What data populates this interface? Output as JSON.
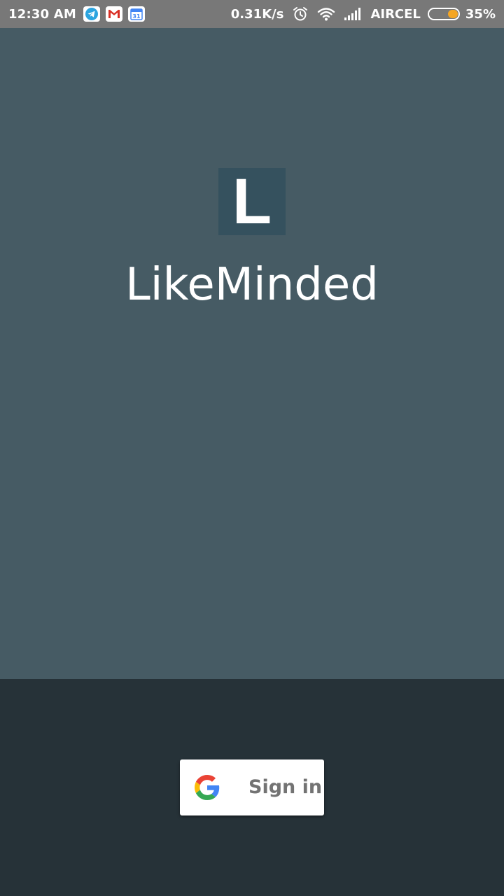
{
  "status_bar": {
    "time": "12:30 AM",
    "net_speed": "0.31K/s",
    "carrier": "AIRCEL",
    "battery_percent": "35%",
    "battery_level": 0.35,
    "battery_color": "#f5a623",
    "icons": [
      "telegram-icon",
      "gmail-icon",
      "calendar-icon",
      "alarm-icon",
      "wifi-icon",
      "signal-icon",
      "battery-icon"
    ],
    "calendar_day": "31"
  },
  "splash": {
    "background": "#465b64",
    "logo_letter": "L",
    "logo_background": "#35515e",
    "app_name": "LikeMinded"
  },
  "bottom": {
    "background": "#263238",
    "signin_label": "Sign in",
    "signin_icon": "google-icon"
  }
}
